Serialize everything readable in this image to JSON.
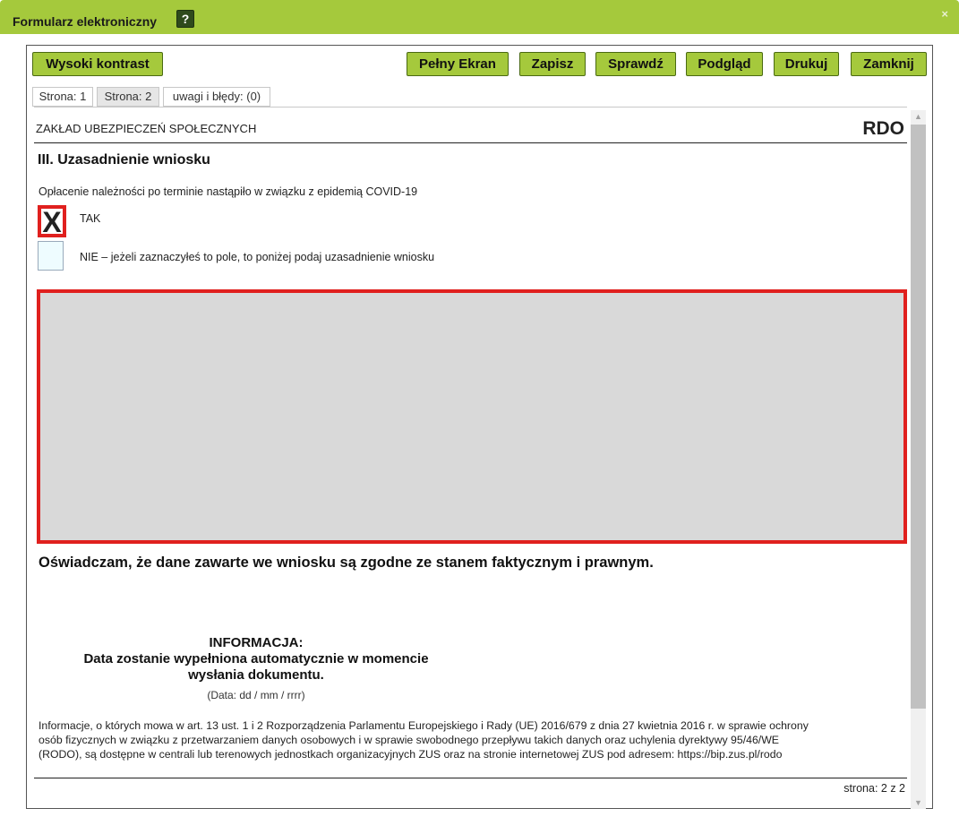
{
  "window": {
    "title": "Formularz elektroniczny",
    "help_icon": "?",
    "close_icon": "×"
  },
  "toolbar": {
    "high_contrast": "Wysoki kontrast",
    "fullscreen": "Pełny Ekran",
    "save": "Zapisz",
    "check": "Sprawdź",
    "preview": "Podgląd",
    "print": "Drukuj",
    "close": "Zamknij"
  },
  "tabs": [
    {
      "label": "Strona: 1",
      "active": false
    },
    {
      "label": "Strona: 2",
      "active": true
    },
    {
      "label": "uwagi i błędy: (0)",
      "active": false
    }
  ],
  "form": {
    "institution": "ZAKŁAD UBEZPIECZEŃ SPOŁECZNYCH",
    "form_code": "RDO",
    "section_title": "III.  Uzasadnienie wniosku",
    "question": "Opłacenie należności po terminie nastąpiło w związku z epidemią COVID-19",
    "option_yes": {
      "label": "TAK",
      "checked": true,
      "mark": "X"
    },
    "option_no": {
      "label": "NIE – jeżeli zaznaczyłeś to pole, to poniżej podaj uzasadnienie wniosku",
      "checked": false
    },
    "justification_value": "",
    "declaration": "Oświadczam, że dane zawarte we wniosku są zgodne ze stanem faktycznym i prawnym.",
    "info_heading": "INFORMACJA:",
    "info_line1": "Data zostanie wypełniona automatycznie w momencie",
    "info_line2": "wysłania dokumentu.",
    "date_format": "(Data: dd / mm / rrrr)",
    "rodo_line1": "Informacje, o których mowa w art. 13 ust. 1 i 2 Rozporządzenia Parlamentu Europejskiego i Rady (UE) 2016/679 z dnia 27 kwietnia 2016 r. w sprawie ochrony",
    "rodo_line2": "osób fizycznych w związku z przetwarzaniem danych osobowych i w sprawie swobodnego przepływu takich danych oraz uchylenia dyrektywy 95/46/WE",
    "rodo_line3": "(RODO), są dostępne w centrali lub terenowych jednostkach organizacyjnych ZUS oraz na stronie internetowej ZUS pod adresem: https://bip.zus.pl/rodo",
    "page_indicator": "strona: 2 z 2"
  },
  "colors": {
    "accent_green": "#a5c93c",
    "error_red": "#e0201e",
    "field_grey": "#d9d9d9"
  },
  "icons": {
    "help": "help-icon",
    "close": "close-icon",
    "scroll_up": "scroll-up-arrow-icon",
    "scroll_down": "scroll-down-arrow-icon"
  }
}
